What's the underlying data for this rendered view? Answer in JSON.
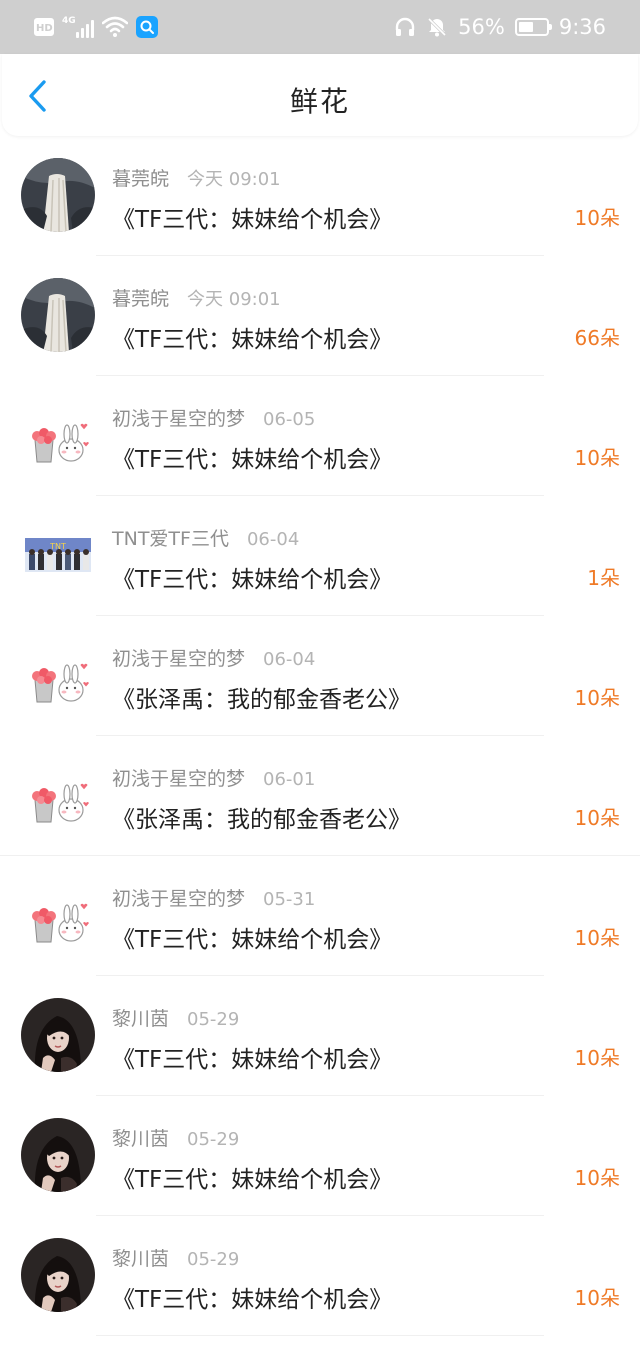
{
  "status_bar": {
    "hd": "HD",
    "network": "4G",
    "battery_percent": "56%",
    "battery_level": 0.56,
    "time": "9:36",
    "icons": [
      "hd-icon",
      "signal-icon",
      "wifi-icon",
      "search-badge-icon",
      "headphones-icon",
      "mute-bell-icon",
      "battery-icon"
    ]
  },
  "header": {
    "title": "鲜花",
    "back_icon": "chevron-left-icon"
  },
  "colors": {
    "accent": "#ef7a27",
    "back": "#1a9bf0",
    "status_bar_bg": "#cfcfcf"
  },
  "rows": [
    {
      "user": "暮莞皖",
      "time": "今天 09:01",
      "title": "《TF三代：妹妹给个机会》",
      "amount": "10朵",
      "avatar": "waterfall"
    },
    {
      "user": "暮莞皖",
      "time": "今天 09:01",
      "title": "《TF三代：妹妹给个机会》",
      "amount": "66朵",
      "avatar": "waterfall"
    },
    {
      "user": "初浅于星空的梦",
      "time": "06-05",
      "title": "《TF三代：妹妹给个机会》",
      "amount": "10朵",
      "avatar": "flower-bunny"
    },
    {
      "user": "TNT爱TF三代",
      "time": "06-04",
      "title": "《TF三代：妹妹给个机会》",
      "amount": "1朵",
      "avatar": "group-photo"
    },
    {
      "user": "初浅于星空的梦",
      "time": "06-04",
      "title": "《张泽禹：我的郁金香老公》",
      "amount": "10朵",
      "avatar": "flower-bunny"
    },
    {
      "user": "初浅于星空的梦",
      "time": "06-01",
      "title": "《张泽禹：我的郁金香老公》",
      "amount": "10朵",
      "avatar": "flower-bunny"
    },
    {
      "user": "初浅于星空的梦",
      "time": "05-31",
      "title": "《TF三代：妹妹给个机会》",
      "amount": "10朵",
      "avatar": "flower-bunny"
    },
    {
      "user": "黎川茵",
      "time": "05-29",
      "title": "《TF三代：妹妹给个机会》",
      "amount": "10朵",
      "avatar": "girl-portrait"
    },
    {
      "user": "黎川茵",
      "time": "05-29",
      "title": "《TF三代：妹妹给个机会》",
      "amount": "10朵",
      "avatar": "girl-portrait"
    },
    {
      "user": "黎川茵",
      "time": "05-29",
      "title": "《TF三代：妹妹给个机会》",
      "amount": "10朵",
      "avatar": "girl-portrait"
    }
  ]
}
